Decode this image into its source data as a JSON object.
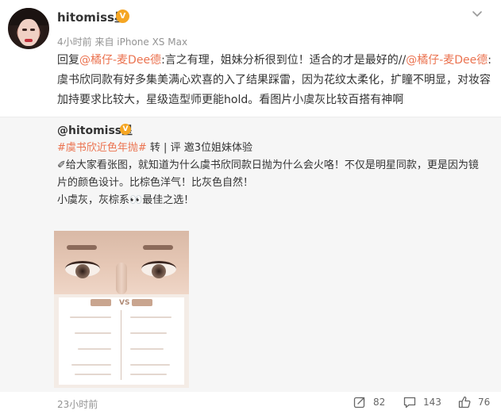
{
  "post": {
    "username": "hitomiss星",
    "meta": "4小时前 来自 iPhone XS Max",
    "reply_prefix": "回复",
    "mention1": "@橘仔-麦Dee德",
    "text1": ":言之有理，姐妹分析很到位！适合的才是最好的//",
    "mention2": "@橘仔-麦Dee德",
    "text2": ":虞书欣同款有好多集美满心欢喜的入了结果踩雷，因为花纹太柔化，扩瞳不明显，对妆容加持要求比较大，星级造型师更能hold。看图片小虞灰比较百搭有神啊"
  },
  "repost": {
    "username": "@hitomiss星",
    "topic": "#虞书欣近色年抛#",
    "topic_suffix": " 转 | 评 邀3位姐妹体验",
    "line2": "✐给大家看张图，就知道为什么虞书欣同款日抛为什么会火咯！不仅是明星同款，更是因为镜片的颜色设计。比棕色洋气！比灰色自然！",
    "line3_a": "小虞灰，灰棕系",
    "line3_emoji": "👀",
    "line3_b": "最佳之选！",
    "image_vs": "VS",
    "time": "23小时前",
    "share_count": "82",
    "comment_count": "143",
    "like_count": "76"
  },
  "colors": {
    "link": "#eb7350",
    "badge": "#f5a623",
    "muted": "#939393",
    "repost_bg": "#f6f6f6"
  },
  "icons": [
    "chevron-down-icon",
    "vip-badge-icon",
    "share-icon",
    "comment-icon",
    "like-icon"
  ]
}
